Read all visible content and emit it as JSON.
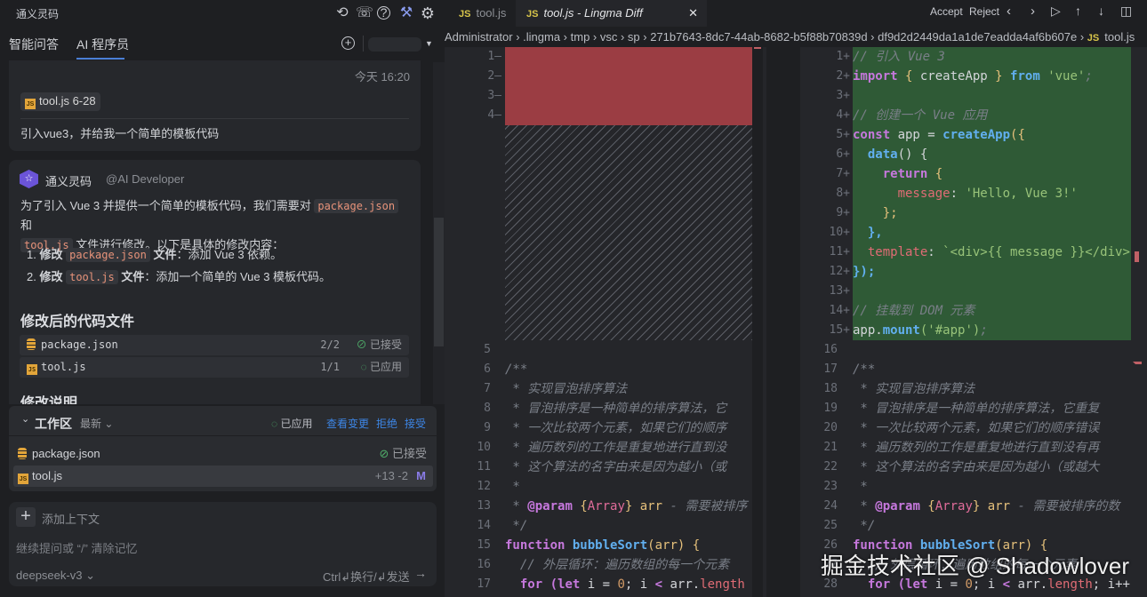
{
  "sidebar": {
    "title": "通义灵码",
    "icons": [
      "history-icon",
      "feedback-icon",
      "help-icon",
      "wrench-icon",
      "gear-icon"
    ],
    "tabs": [
      {
        "label": "智能问答"
      },
      {
        "label": "AI 程序员",
        "active": true
      }
    ],
    "user_message": {
      "time": "今天 16:20",
      "chip": "tool.js 6-28",
      "text": "引入vue3，并给我一个简单的模板代码"
    },
    "reply": {
      "author": "通义灵码",
      "role": "@AI Developer",
      "p1a": "为了引入 Vue 3 并提供一个简单的模板代码，我们需要对",
      "p1code1": "package.json",
      "p1b": "和",
      "p1code2": "tool.js",
      "p1c": "文件进行修改。以下是具体的修改内容：",
      "items": [
        {
          "n": "1.",
          "a": "修改",
          "code": "package.json",
          "b": "文件",
          "c": "：添加 Vue 3 依赖。"
        },
        {
          "n": "2.",
          "a": "修改",
          "code": "tool.js",
          "b": "文件",
          "c": "：添加一个简单的 Vue 3 模板代码。"
        }
      ],
      "files_heading": "修改后的代码文件",
      "files": [
        {
          "name": "package.json",
          "count": "2/2",
          "status": "已接受"
        },
        {
          "name": "tool.js",
          "count": "1/1",
          "status": "已应用"
        }
      ],
      "notes_heading": "修改说明"
    },
    "workspace": {
      "title": "工作区",
      "filter": "最新",
      "status": "已应用",
      "view": "查看变更",
      "reject": "拒绝",
      "accept": "接受",
      "files": [
        {
          "name": "package.json",
          "status": "已接受"
        },
        {
          "name": "tool.js",
          "diff": "+13 -2",
          "badge": "M"
        }
      ]
    },
    "input": {
      "add_context": "添加上下文",
      "placeholder": "继续提问或 “/” 清除记忆",
      "model": "deepseek-v3",
      "hint": "Ctrl↲换行/↲发送"
    }
  },
  "editor": {
    "tabs": [
      {
        "label": "tool.js"
      },
      {
        "label": "tool.js - Lingma Diff",
        "active": true
      }
    ],
    "toolbar": {
      "accept": "Accept",
      "reject": "Reject"
    },
    "breadcrumb": [
      "Administrator",
      ".lingma",
      "tmp",
      "vsc",
      "sp",
      "271b7643-8dc7-44ab-8682-b5f88b70839d",
      "df9d2d2449da1a1de7eadda4af6b607e",
      "tool.js"
    ],
    "colors": {
      "removed": "#9b3d43",
      "added": "#2f5a36"
    },
    "left": {
      "removed_lines": [
        "1",
        "2",
        "3",
        "4"
      ],
      "lines": [
        {
          "n": "5",
          "t": []
        },
        {
          "n": "6",
          "t": [
            [
              "/**",
              "cm"
            ]
          ]
        },
        {
          "n": "7",
          "t": [
            [
              " * 实现冒泡排序算法",
              "cm"
            ]
          ]
        },
        {
          "n": "8",
          "t": [
            [
              " * 冒泡排序是一种简单的排序算法，它",
              "cm"
            ]
          ]
        },
        {
          "n": "9",
          "t": [
            [
              " * 一次比较两个元素，如果它们的顺序",
              "cm"
            ]
          ]
        },
        {
          "n": "10",
          "t": [
            [
              " * 遍历数列的工作是重复地进行直到没",
              "cm"
            ]
          ]
        },
        {
          "n": "11",
          "t": [
            [
              " * 这个算法的名字由来是因为越小（或",
              "cm"
            ]
          ]
        },
        {
          "n": "12",
          "t": [
            [
              " *",
              "cm"
            ]
          ]
        },
        {
          "n": "13",
          "t": [
            [
              " * ",
              "cm"
            ],
            [
              "@param",
              "tg"
            ],
            [
              " {",
              "br"
            ],
            [
              "Array",
              "ty"
            ],
            [
              "}",
              "br"
            ],
            [
              " arr",
              "var"
            ],
            [
              " - 需要被排序",
              "cm"
            ]
          ]
        },
        {
          "n": "14",
          "t": [
            [
              " */",
              "cm"
            ]
          ]
        },
        {
          "n": "15",
          "t": [
            [
              "function ",
              "kw"
            ],
            [
              "bubbleSort",
              "fn"
            ],
            [
              "(",
              "br"
            ],
            [
              "arr",
              "var"
            ],
            [
              ") {",
              "br"
            ]
          ]
        },
        {
          "n": "16",
          "t": [
            [
              "  // 外层循环：遍历数组的每一个元素",
              "cm"
            ]
          ]
        },
        {
          "n": "17",
          "t": [
            [
              "  for ",
              "kw"
            ],
            [
              "(",
              "kw"
            ],
            [
              "let ",
              "kw"
            ],
            [
              "i = ",
              "pl"
            ],
            [
              "0",
              "nm"
            ],
            [
              "; i ",
              "pl"
            ],
            [
              "<",
              "kw"
            ],
            [
              " arr.",
              "pl"
            ],
            [
              "length",
              "pr"
            ]
          ]
        }
      ]
    },
    "right": {
      "added": [
        {
          "n": "1+",
          "t": [
            [
              "// 引入 Vue 3",
              "cm"
            ]
          ]
        },
        {
          "n": "2+",
          "t": [
            [
              "import ",
              "kw"
            ],
            [
              "{ ",
              "br"
            ],
            [
              "createApp ",
              "pl"
            ],
            [
              "} ",
              "br"
            ],
            [
              "from ",
              "fn"
            ],
            [
              "'vue'",
              "str"
            ],
            [
              ";",
              "cm"
            ]
          ]
        },
        {
          "n": "3+",
          "t": []
        },
        {
          "n": "4+",
          "t": [
            [
              "// 创建一个 Vue 应用",
              "cm"
            ]
          ]
        },
        {
          "n": "5+",
          "t": [
            [
              "const ",
              "kw"
            ],
            [
              "app = ",
              "pl"
            ],
            [
              "createApp",
              "fn"
            ],
            [
              "({",
              "br"
            ]
          ]
        },
        {
          "n": "6+",
          "t": [
            [
              "  data",
              "fn"
            ],
            [
              "() {",
              "pl"
            ]
          ]
        },
        {
          "n": "7+",
          "t": [
            [
              "    return ",
              "kw"
            ],
            [
              "{",
              "br"
            ]
          ]
        },
        {
          "n": "8+",
          "t": [
            [
              "      message",
              "pr"
            ],
            [
              ": ",
              "pl"
            ],
            [
              "'Hello, Vue 3!'",
              "str"
            ]
          ]
        },
        {
          "n": "9+",
          "t": [
            [
              "    };",
              "br"
            ]
          ]
        },
        {
          "n": "10+",
          "t": [
            [
              "  },",
              "fn"
            ]
          ]
        },
        {
          "n": "11+",
          "t": [
            [
              "  template",
              "pr"
            ],
            [
              ": ",
              "pl"
            ],
            [
              "`<div>{{ message }}</div>`",
              "str"
            ]
          ]
        },
        {
          "n": "12+",
          "t": [
            [
              "});",
              "fn"
            ]
          ]
        },
        {
          "n": "13+",
          "t": []
        },
        {
          "n": "14+",
          "t": [
            [
              "// 挂载到 DOM 元素",
              "cm"
            ]
          ]
        },
        {
          "n": "15+",
          "t": [
            [
              "app.",
              "pl"
            ],
            [
              "mount",
              "fn"
            ],
            [
              "('#app')",
              "str"
            ],
            [
              ";",
              "cm"
            ]
          ]
        }
      ],
      "lines": [
        {
          "n": "16",
          "t": []
        },
        {
          "n": "17",
          "t": [
            [
              "/**",
              "cm"
            ]
          ]
        },
        {
          "n": "18",
          "t": [
            [
              " * 实现冒泡排序算法",
              "cm"
            ]
          ]
        },
        {
          "n": "19",
          "t": [
            [
              " * 冒泡排序是一种简单的排序算法，它重复",
              "cm"
            ]
          ]
        },
        {
          "n": "20",
          "t": [
            [
              " * 一次比较两个元素，如果它们的顺序错误",
              "cm"
            ]
          ]
        },
        {
          "n": "21",
          "t": [
            [
              " * 遍历数列的工作是重复地进行直到没有再",
              "cm"
            ]
          ]
        },
        {
          "n": "22",
          "t": [
            [
              " * 这个算法的名字由来是因为越小（或越大",
              "cm"
            ]
          ]
        },
        {
          "n": "23",
          "t": [
            [
              " *",
              "cm"
            ]
          ]
        },
        {
          "n": "24",
          "t": [
            [
              " * ",
              "cm"
            ],
            [
              "@param",
              "tg"
            ],
            [
              " {",
              "br"
            ],
            [
              "Array",
              "ty"
            ],
            [
              "}",
              "br"
            ],
            [
              " arr",
              "var"
            ],
            [
              " - 需要被排序的数",
              "cm"
            ]
          ]
        },
        {
          "n": "25",
          "t": [
            [
              " */",
              "cm"
            ]
          ]
        },
        {
          "n": "26",
          "t": [
            [
              "function ",
              "kw"
            ],
            [
              "bubbleSort",
              "fn"
            ],
            [
              "(",
              "br"
            ],
            [
              "arr",
              "var"
            ],
            [
              ") {",
              "br"
            ]
          ]
        },
        {
          "n": "27",
          "t": [
            [
              "  // 外层循环：遍历数组的每一个元素",
              "cm"
            ]
          ]
        },
        {
          "n": "28",
          "t": [
            [
              "  for ",
              "kw"
            ],
            [
              "(",
              "kw"
            ],
            [
              "let ",
              "kw"
            ],
            [
              "i = ",
              "pl"
            ],
            [
              "0",
              "nm"
            ],
            [
              "; i ",
              "pl"
            ],
            [
              "<",
              "kw"
            ],
            [
              " arr.",
              "pl"
            ],
            [
              "length",
              "pr"
            ],
            [
              "; i++",
              "pl"
            ]
          ]
        }
      ]
    }
  },
  "watermark": "掘金技术社区 @ Shadowlover"
}
